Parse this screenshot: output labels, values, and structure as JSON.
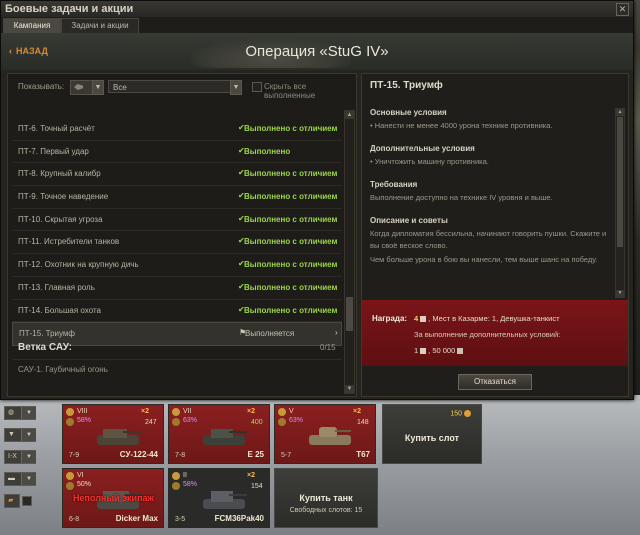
{
  "window": {
    "title": "Боевые задачи и акции"
  },
  "tabs": [
    {
      "label": "Кампания"
    },
    {
      "label": "Задачи и акции"
    }
  ],
  "header": {
    "back_label": "НАЗАД",
    "operation_title": "Операция «StuG IV»"
  },
  "filter": {
    "show_label": "Показывать:",
    "select_value": "Все",
    "hide_done_label": "Скрыть все выполненные"
  },
  "quests": [
    {
      "name": "ПТ-6. Точный расчёт",
      "status": "Выполнено с отличием",
      "state": "excellent"
    },
    {
      "name": "ПТ-7. Первый удар",
      "status": "Выполнено",
      "state": "done"
    },
    {
      "name": "ПТ-8. Крупный калибр",
      "status": "Выполнено с отличием",
      "state": "excellent"
    },
    {
      "name": "ПТ-9. Точное наведение",
      "status": "Выполнено с отличием",
      "state": "excellent"
    },
    {
      "name": "ПТ-10. Скрытая угроза",
      "status": "Выполнено с отличием",
      "state": "excellent"
    },
    {
      "name": "ПТ-11. Истребители танков",
      "status": "Выполнено с отличием",
      "state": "excellent"
    },
    {
      "name": "ПТ-12. Охотник на крупную дичь",
      "status": "Выполнено с отличием",
      "state": "excellent"
    },
    {
      "name": "ПТ-13. Главная роль",
      "status": "Выполнено с отличием",
      "state": "excellent"
    },
    {
      "name": "ПТ-14. Большая охота",
      "status": "Выполнено с отличием",
      "state": "excellent"
    },
    {
      "name": "ПТ-15. Триумф",
      "status": "Выполняется",
      "state": "current"
    }
  ],
  "branch": {
    "title": "Ветка САУ:",
    "count": "0/15",
    "first_item": "САУ-1. Гаубичный огонь"
  },
  "detail": {
    "title": "ПТ-15. Триумф",
    "sections": [
      {
        "head": "Основные условия",
        "text": "• Нанести не менее 4000 урона технике противника."
      },
      {
        "head": "Дополнительные условия",
        "text": "• Уничтожить машину противника."
      },
      {
        "head": "Требования",
        "text": "Выполнение доступно на технике IV уровня и выше."
      },
      {
        "head": "Описание и советы",
        "text": "Когда дипломатия бессильна, начинают говорить пушки. Скажите и вы своё веское слово.",
        "text2": "Чем больше урона в бою вы нанесли, тем выше шанс на победу."
      }
    ],
    "reward": {
      "label": "Награда:",
      "line1_num": "4",
      "line1_text": ", Мест в Казарме: 1, Девушка-танкист",
      "line2": "За выполнение дополнительных условий:",
      "line3_num": "1",
      "line3_text": ", 50 000"
    },
    "refuse_label": "Отказаться"
  },
  "tools": [
    {
      "label": ""
    },
    {
      "label": "▼"
    },
    {
      "label": "I-X"
    },
    {
      "label": ""
    }
  ],
  "vehicles": [
    {
      "tier": "VIII",
      "pct": "58%",
      "x2": "×2",
      "exp": "247",
      "name": "СУ-122-44",
      "battles": "7-9",
      "type": "red"
    },
    {
      "tier": "VII",
      "pct": "63%",
      "x2": "×2",
      "exp": "400",
      "name": "E 25",
      "battles": "7-8",
      "type": "red"
    },
    {
      "tier": "V",
      "pct": "63%",
      "x2": "×2",
      "exp": "148",
      "name": "T67",
      "battles": "5-7",
      "type": "red"
    },
    {
      "tier": "VI",
      "pct": "50%",
      "x2": "",
      "exp": "",
      "name": "Dicker Max",
      "battles": "6-8",
      "type": "red",
      "crew": "Неполный экипаж"
    },
    {
      "tier": "II",
      "pct": "58%",
      "x2": "×2",
      "exp": "154",
      "name": "FCM36Pak40",
      "battles": "3-5",
      "type": "dark"
    }
  ],
  "buy_slot": {
    "label": "Купить слот",
    "price": "150"
  },
  "buy_tank": {
    "label": "Купить танк",
    "sub": "Свободных слотов: 15"
  },
  "colors": {
    "accent_green": "#9bd44a",
    "reward_red": "#7a1518",
    "back_orange": "#d58b3a"
  }
}
